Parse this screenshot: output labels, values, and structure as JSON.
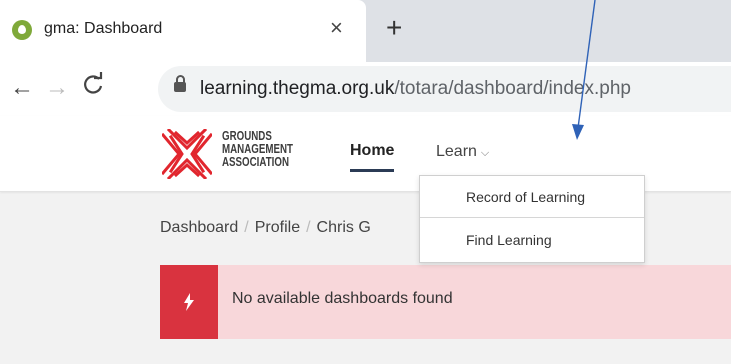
{
  "browser": {
    "tab": {
      "title": "gma: Dashboard",
      "close_glyph": "×",
      "favicon": "leaf-icon"
    },
    "new_tab_glyph": "+",
    "nav": {
      "back": "←",
      "forward": "→",
      "reload": "C"
    },
    "url": {
      "host": "learning.thegma.org.uk",
      "path": "/totara/dashboard/index.php"
    }
  },
  "site": {
    "logo": {
      "line1": "GROUNDS",
      "line2": "MANAGEMENT",
      "line3": "ASSOCIATION",
      "color": "#e1262e"
    },
    "nav": {
      "home": "Home",
      "learn": "Learn",
      "learn_chevron": "⌵",
      "dropdown": [
        "Record of Learning",
        "Find Learning"
      ]
    }
  },
  "breadcrumb": [
    "Dashboard",
    "Profile",
    "Chris G"
  ],
  "breadcrumb_sep": "/",
  "alert": {
    "message": "No available dashboards found",
    "color": "#d9333f"
  },
  "annotation": {
    "arrow_color": "#2f62b7"
  }
}
